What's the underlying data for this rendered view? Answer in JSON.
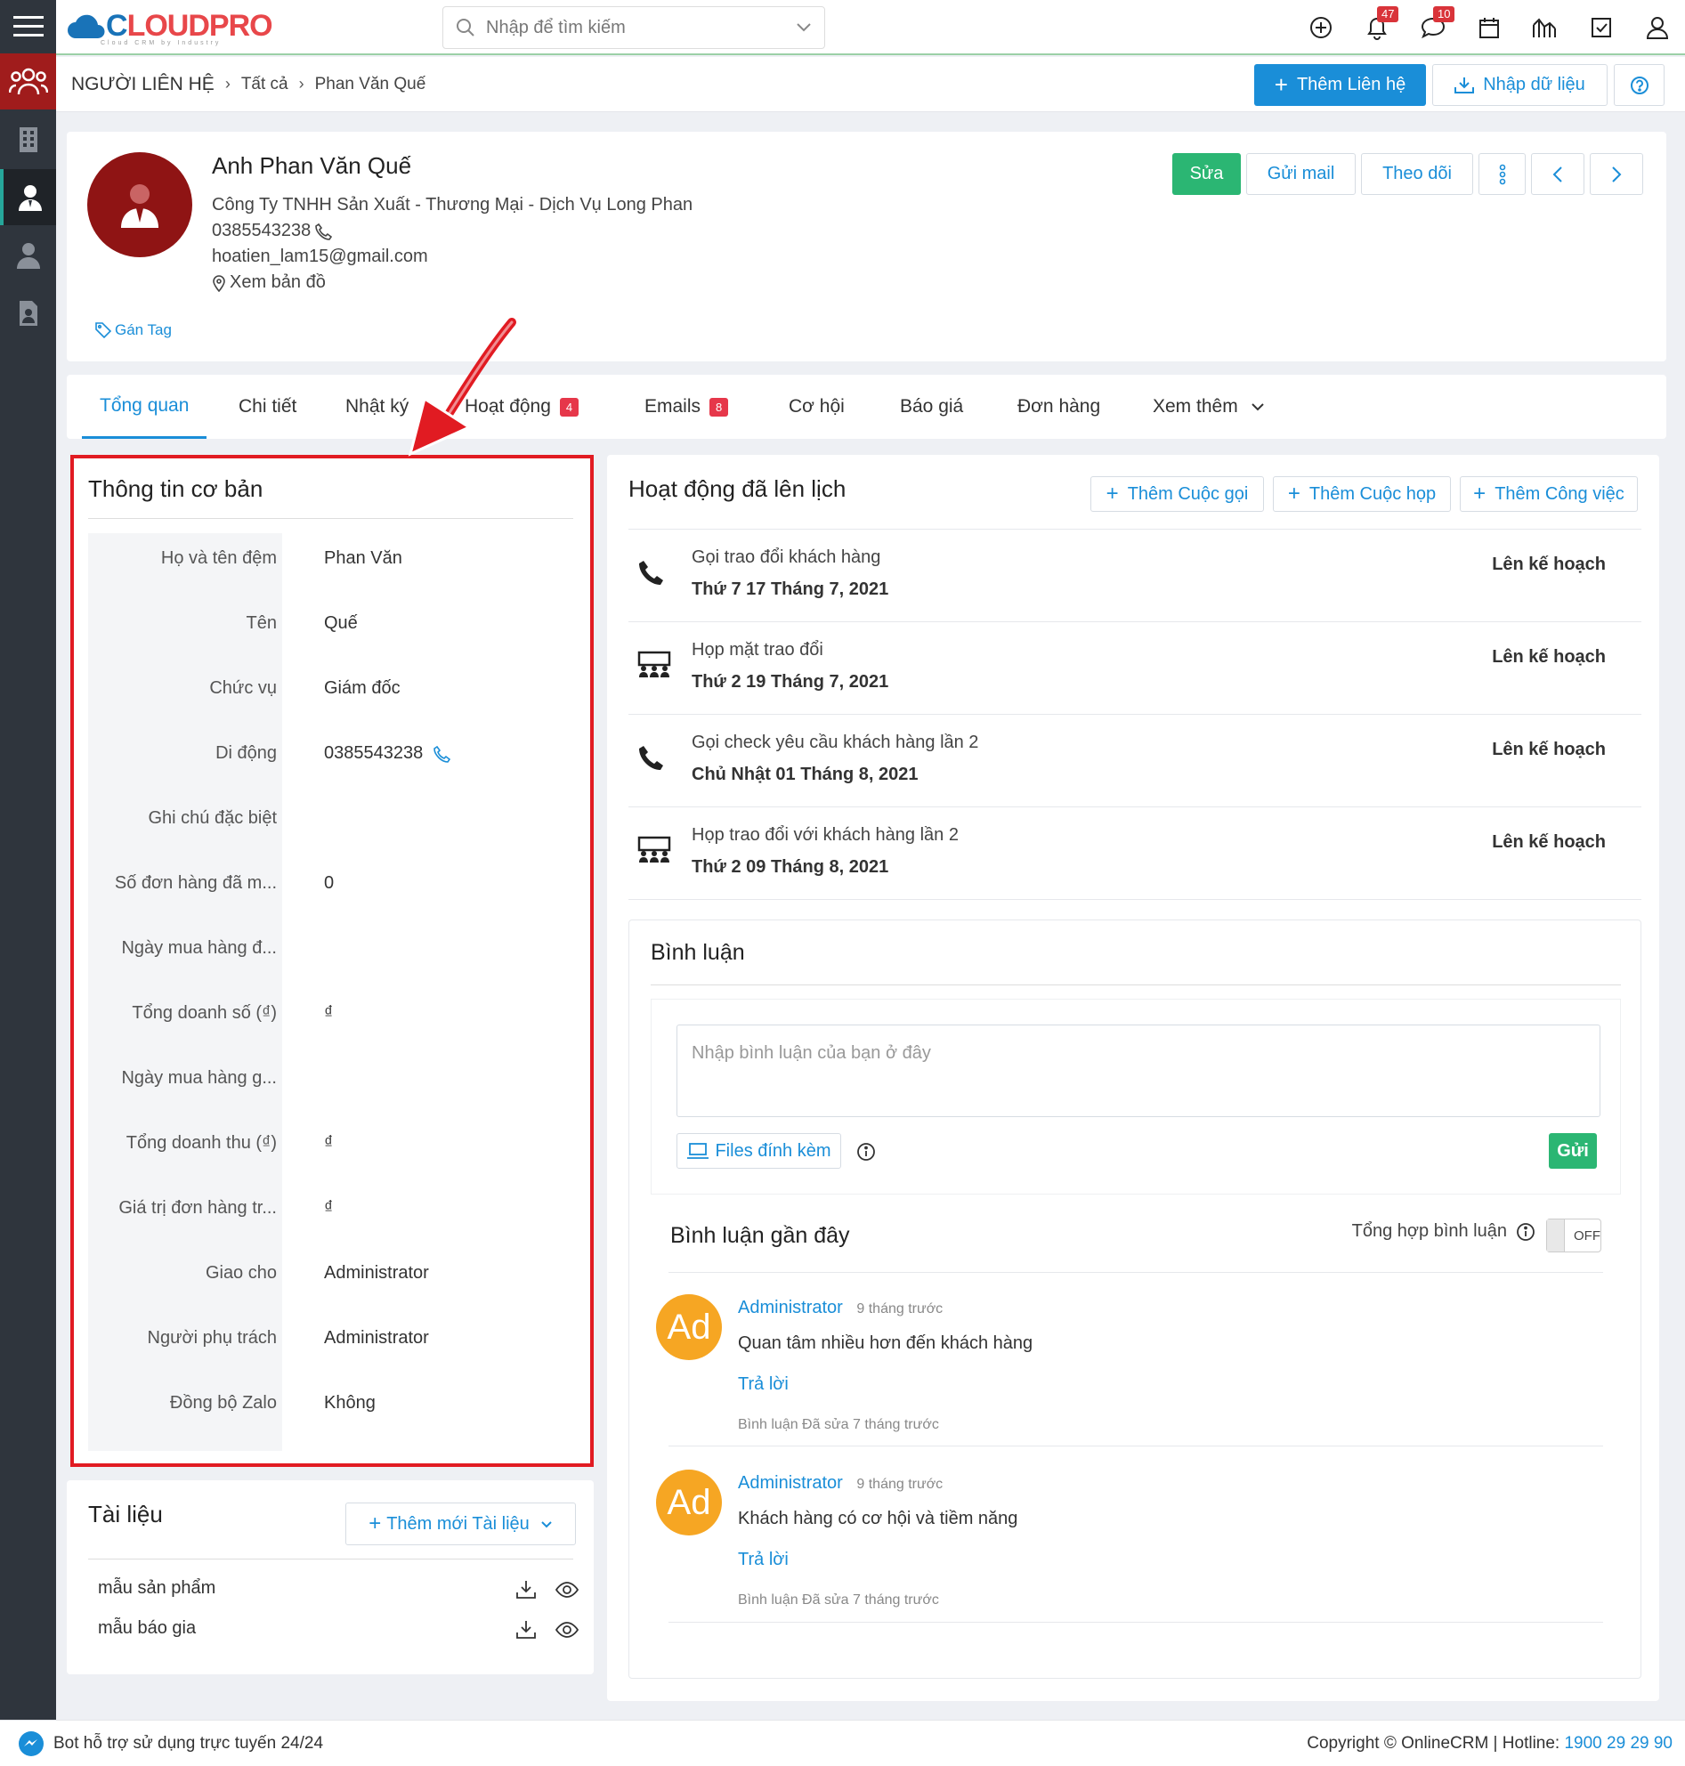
{
  "logo": {
    "text_c": "C",
    "text_rest": "LOUDPRO",
    "tagline": "Cloud CRM by Industry"
  },
  "search": {
    "placeholder": "Nhập để tìm kiếm"
  },
  "top_icons": {
    "notifications_count": "47",
    "messages_count": "10"
  },
  "breadcrumb": {
    "module": "NGƯỜI LIÊN HỆ",
    "all": "Tất cả",
    "current": "Phan Văn Quế"
  },
  "toolbar": {
    "add_contact": "Thêm Liên hệ",
    "import_data": "Nhập dữ liệu"
  },
  "profile": {
    "name": "Anh Phan Văn Quế",
    "company": "Công Ty TNHH Sản Xuất - Thương Mại - Dịch Vụ Long Phan",
    "phone": "0385543238",
    "email": "hoatien_lam15@gmail.com",
    "map_link": "Xem bản đồ",
    "tag_link": "Gán Tag",
    "buttons": {
      "edit": "Sửa",
      "send_mail": "Gửi mail",
      "follow": "Theo dõi"
    }
  },
  "tabs": [
    {
      "label": "Tổng quan"
    },
    {
      "label": "Chi tiết"
    },
    {
      "label": "Nhật ký"
    },
    {
      "label": "Hoạt động",
      "badge": "4"
    },
    {
      "label": "Emails",
      "badge": "8"
    },
    {
      "label": "Cơ hội"
    },
    {
      "label": "Báo giá"
    },
    {
      "label": "Đơn hàng"
    },
    {
      "label": "Xem thêm"
    }
  ],
  "basic_info": {
    "title": "Thông tin cơ bản",
    "rows": [
      {
        "label": "Họ và tên đệm",
        "value": "Phan Văn"
      },
      {
        "label": "Tên",
        "value": "Quế"
      },
      {
        "label": "Chức vụ",
        "value": "Giám đốc"
      },
      {
        "label": "Di động",
        "value": "0385543238"
      },
      {
        "label": "Ghi chú đặc biệt",
        "value": ""
      },
      {
        "label": "Số đơn hàng đã m...",
        "value": "0"
      },
      {
        "label": "Ngày mua hàng đ...",
        "value": ""
      },
      {
        "label": "Tổng doanh số (₫)",
        "value": "₫"
      },
      {
        "label": "Ngày mua hàng g...",
        "value": ""
      },
      {
        "label": "Tổng doanh thu (₫)",
        "value": "₫"
      },
      {
        "label": "Giá trị đơn hàng tr...",
        "value": "₫"
      },
      {
        "label": "Giao cho",
        "value": "Administrator"
      },
      {
        "label": "Người phụ trách",
        "value": "Administrator"
      },
      {
        "label": "Đồng bộ Zalo",
        "value": "Không"
      }
    ]
  },
  "documents": {
    "title": "Tài liệu",
    "add_button": "Thêm mới Tài liệu",
    "items": [
      {
        "name": "mẫu sản phẩm"
      },
      {
        "name": "mẫu báo gia"
      }
    ]
  },
  "activities": {
    "title": "Hoạt động đã lên lịch",
    "add_call": "Thêm Cuộc gọi",
    "add_meeting": "Thêm Cuộc họp",
    "add_task": "Thêm Công việc",
    "items": [
      {
        "icon": "phone-icon",
        "title": "Gọi trao đổi khách hàng",
        "date": "Thứ 7 17 Tháng 7, 2021",
        "status": "Lên kế hoạch"
      },
      {
        "icon": "meeting-icon",
        "title": "Họp mặt trao đổi",
        "date": "Thứ 2 19 Tháng 7, 2021",
        "status": "Lên kế hoạch"
      },
      {
        "icon": "phone-icon",
        "title": "Gọi check yêu cầu khách hàng lần 2",
        "date": "Chủ Nhật 01 Tháng 8, 2021",
        "status": "Lên kế hoạch"
      },
      {
        "icon": "meeting-icon",
        "title": "Họp trao đổi với khách hàng lần 2",
        "date": "Thứ 2 09 Tháng 8, 2021",
        "status": "Lên kế hoạch"
      }
    ]
  },
  "comments": {
    "title": "Bình luận",
    "placeholder": "Nhập bình luận của bạn ở đây",
    "attach_button": "Files đính kèm",
    "send_button": "Gửi",
    "recent_title": "Bình luận gần đây",
    "summary_label": "Tổng hợp bình luận",
    "toggle_state": "OFF",
    "items": [
      {
        "avatar": "Ad",
        "author": "Administrator",
        "time": "9 tháng trước",
        "text": "Quan tâm nhiều hơn đến khách hàng",
        "reply": "Trả lời",
        "edited": "Bình luận Đã sửa 7 tháng trước"
      },
      {
        "avatar": "Ad",
        "author": "Administrator",
        "time": "9 tháng trước",
        "text": "Khách hàng có cơ hội và tiềm năng",
        "reply": "Trả lời",
        "edited": "Bình luận Đã sửa 7 tháng trước"
      }
    ]
  },
  "footer": {
    "bot_text": "Bot hỗ trợ sử dụng trực tuyến 24/24",
    "copyright": "Copyright © OnlineCRM | Hotline: ",
    "hotline": "1900 29 29 90"
  },
  "colors": {
    "primary": "#1a8ed8",
    "green": "#2bb673",
    "annotation_red": "#e11b22",
    "sidebar": "#2f353d"
  }
}
